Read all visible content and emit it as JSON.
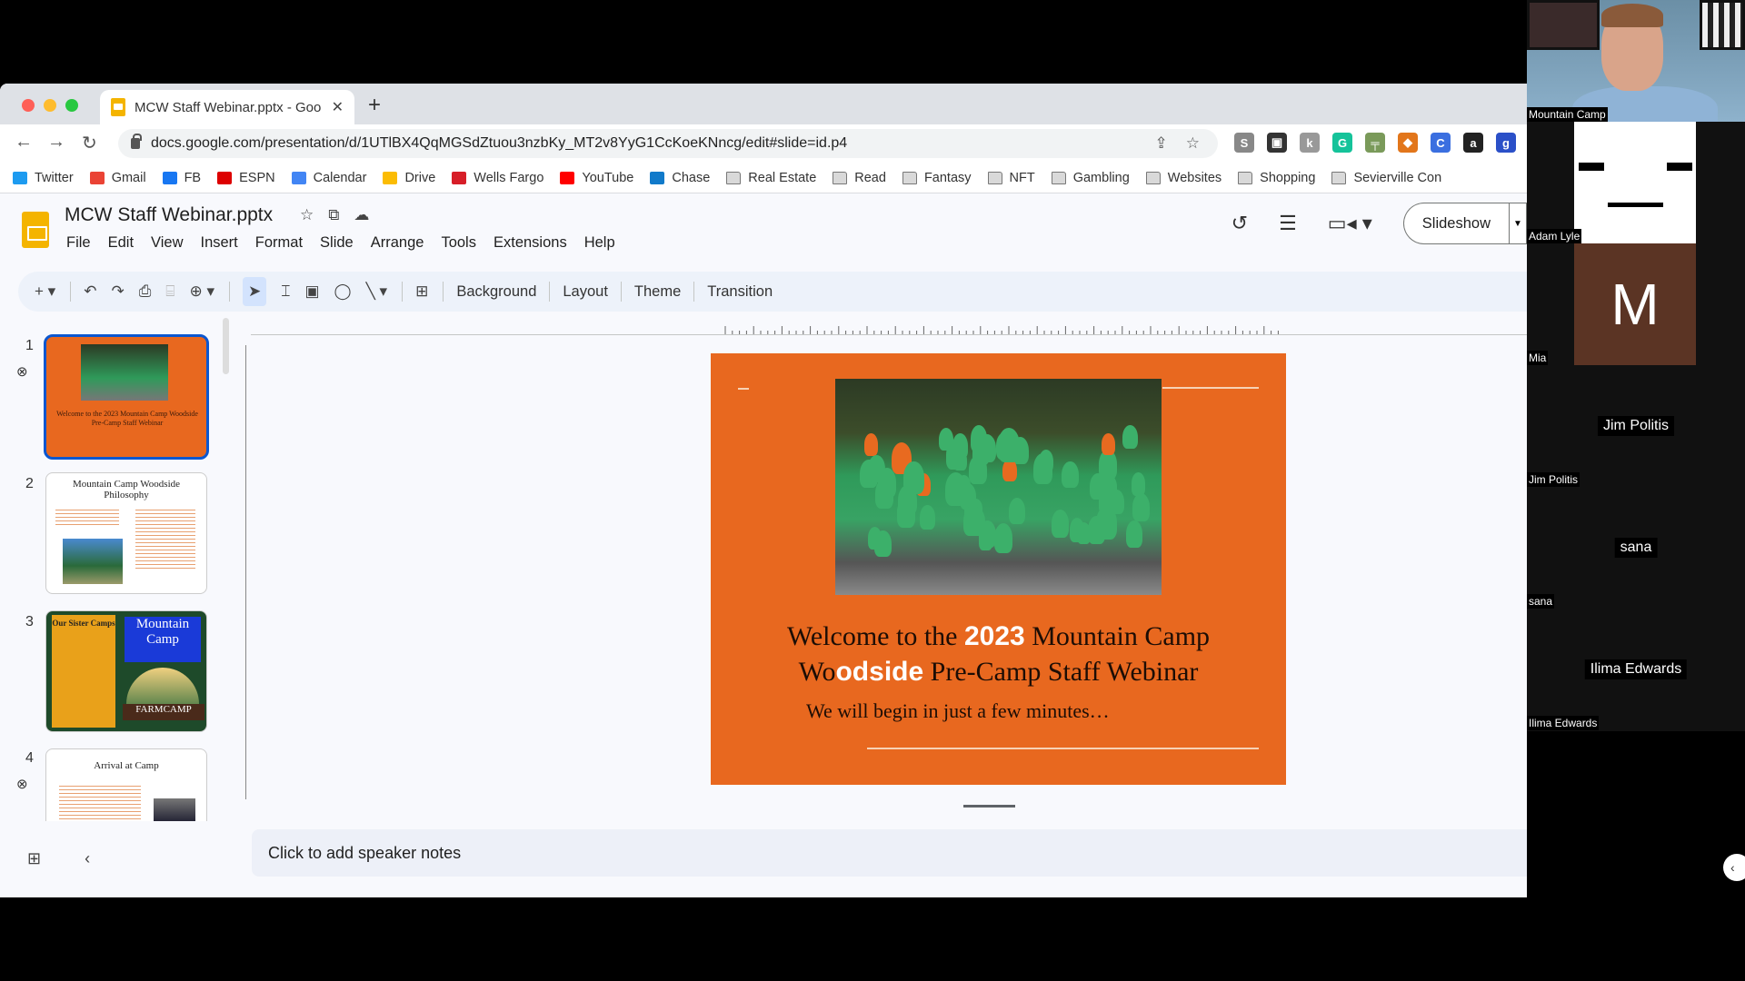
{
  "browser": {
    "tab_title": "MCW Staff Webinar.pptx - Goo",
    "new_tab": "+",
    "url": "docs.google.com/presentation/d/1UTlBX4QqMGSdZtuou3nzbKy_MT2v8YyG1CcKoeKNncg/edit#slide=id.p4",
    "bookmarks": [
      {
        "label": "Twitter",
        "icon": "twitter-icon",
        "color": "#1d9bf0"
      },
      {
        "label": "Gmail",
        "icon": "gmail-icon",
        "color": "#ea4335"
      },
      {
        "label": "FB",
        "icon": "facebook-icon",
        "color": "#1877f2"
      },
      {
        "label": "ESPN",
        "icon": "espn-icon",
        "color": "#d00"
      },
      {
        "label": "Calendar",
        "icon": "calendar-icon",
        "color": "#4285f4"
      },
      {
        "label": "Drive",
        "icon": "drive-icon",
        "color": "#fbbc04"
      },
      {
        "label": "Wells Fargo",
        "icon": "wells-fargo-icon",
        "color": "#d71e28"
      },
      {
        "label": "YouTube",
        "icon": "youtube-icon",
        "color": "#ff0000"
      },
      {
        "label": "Chase",
        "icon": "chase-icon",
        "color": "#117aca"
      },
      {
        "label": "Real Estate",
        "icon": "folder-icon"
      },
      {
        "label": "Read",
        "icon": "folder-icon"
      },
      {
        "label": "Fantasy",
        "icon": "folder-icon"
      },
      {
        "label": "NFT",
        "icon": "folder-icon"
      },
      {
        "label": "Gambling",
        "icon": "folder-icon"
      },
      {
        "label": "Websites",
        "icon": "folder-icon"
      },
      {
        "label": "Shopping",
        "icon": "folder-icon"
      },
      {
        "label": "Sevierville Con",
        "icon": "folder-icon"
      }
    ],
    "extensions": [
      {
        "name": "s-extension-icon",
        "glyph": "S",
        "color": "#888"
      },
      {
        "name": "wallet-extension-icon",
        "glyph": "▣",
        "color": "#333"
      },
      {
        "name": "scraper-extension-icon",
        "glyph": "k",
        "color": "#999"
      },
      {
        "name": "grammarly-icon",
        "glyph": "G",
        "color": "#15c39a"
      },
      {
        "name": "gun-extension-icon",
        "glyph": "╤",
        "color": "#7a9a5a"
      },
      {
        "name": "metamask-icon",
        "glyph": "◆",
        "color": "#e2761b"
      },
      {
        "name": "c-extension-icon",
        "glyph": "C",
        "color": "#3b6fe0"
      },
      {
        "name": "amazon-icon",
        "glyph": "a",
        "color": "#222"
      },
      {
        "name": "g-extension-icon",
        "glyph": "g",
        "color": "#2b50c8"
      }
    ]
  },
  "app": {
    "doc_title": "MCW Staff Webinar.pptx",
    "menu": [
      "File",
      "Edit",
      "View",
      "Insert",
      "Format",
      "Slide",
      "Arrange",
      "Tools",
      "Extensions",
      "Help"
    ],
    "slideshow_label": "Slideshow",
    "toolbar_text_buttons": [
      "Background",
      "Layout",
      "Theme",
      "Transition"
    ],
    "accent_color": "#0b57d0"
  },
  "filmstrip": {
    "slides": [
      {
        "number": "1",
        "title": "Welcome to the 2023 Mountain Camp Woodside Pre-Camp Staff Webinar",
        "selected": true,
        "linked": true
      },
      {
        "number": "2",
        "title": "Mountain Camp Woodside Philosophy",
        "selected": false,
        "linked": false
      },
      {
        "number": "3",
        "title": "Our Sister Camps",
        "selected": false,
        "linked": false
      },
      {
        "number": "4",
        "title": "Arrival at Camp",
        "selected": false,
        "linked": true
      }
    ],
    "thumb3_logo1": "Mountain Camp",
    "thumb3_logo2": "FARMCAMP"
  },
  "slide": {
    "title_part1": "Welcome to the ",
    "title_highlight1": "2023",
    "title_part2": " Mountain Camp",
    "title_part3": "Wo",
    "title_highlight2": "odside",
    "title_part4": " Pre-Camp Staff Webinar",
    "subtitle": "We will begin in just a few minutes…",
    "background_color": "#e8681f"
  },
  "notes": {
    "placeholder": "Click to add speaker notes"
  },
  "participants": [
    {
      "name": "Mountain Camp",
      "type": "video"
    },
    {
      "name": "Adam Lyle",
      "type": "avatar-face"
    },
    {
      "name": "Mia",
      "type": "initial",
      "initial": "M"
    },
    {
      "name": "Jim Politis",
      "type": "name-only"
    },
    {
      "name": "sana",
      "type": "name-only"
    },
    {
      "name": "Ilima Edwards",
      "type": "name-only"
    }
  ]
}
